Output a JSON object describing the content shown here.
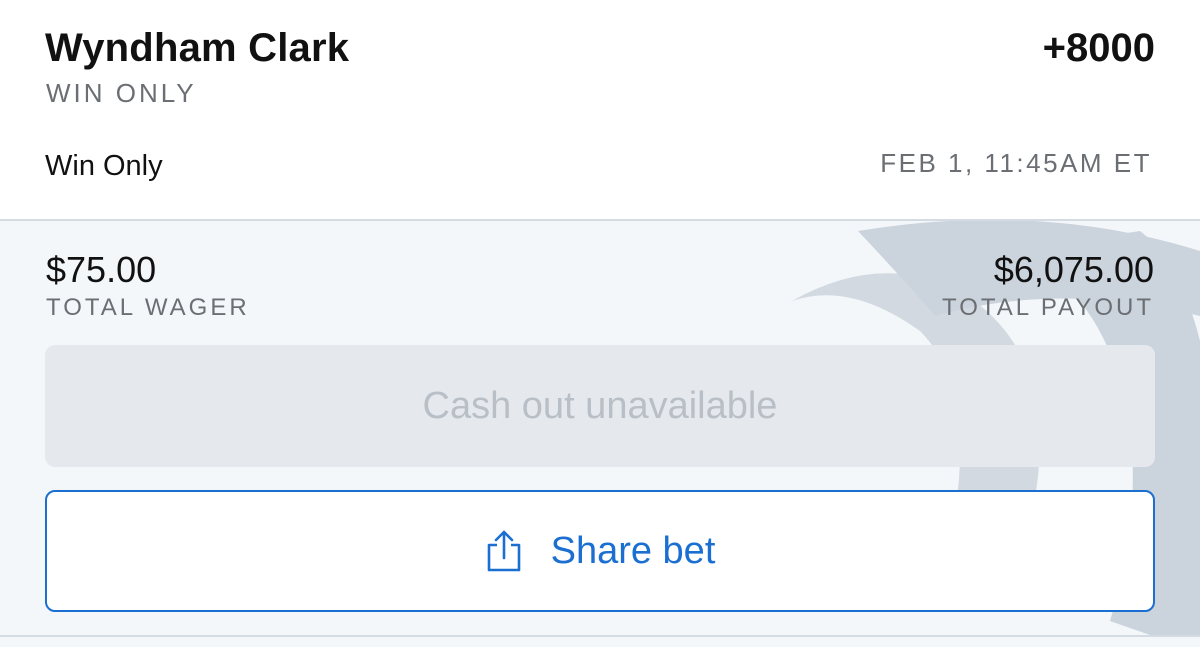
{
  "bet": {
    "selection": "Wyndham Clark",
    "odds": "+8000",
    "market": "WIN ONLY",
    "bet_type": "Win Only",
    "event_time": "FEB 1, 11:45AM ET"
  },
  "summary": {
    "wager_amount": "$75.00",
    "wager_label": "TOTAL WAGER",
    "payout_amount": "$6,075.00",
    "payout_label": "TOTAL PAYOUT"
  },
  "actions": {
    "cashout_label": "Cash out unavailable",
    "share_label": "Share bet"
  },
  "icons": {
    "share": "share-icon",
    "watermark": "brand-watermark"
  },
  "colors": {
    "accent": "#1a6fd1",
    "text_primary": "#111111",
    "text_secondary": "#6b6f73",
    "panel_background": "#f4f7fa",
    "disabled_button": "#e5e9ee",
    "disabled_text": "#b9bfc6"
  }
}
